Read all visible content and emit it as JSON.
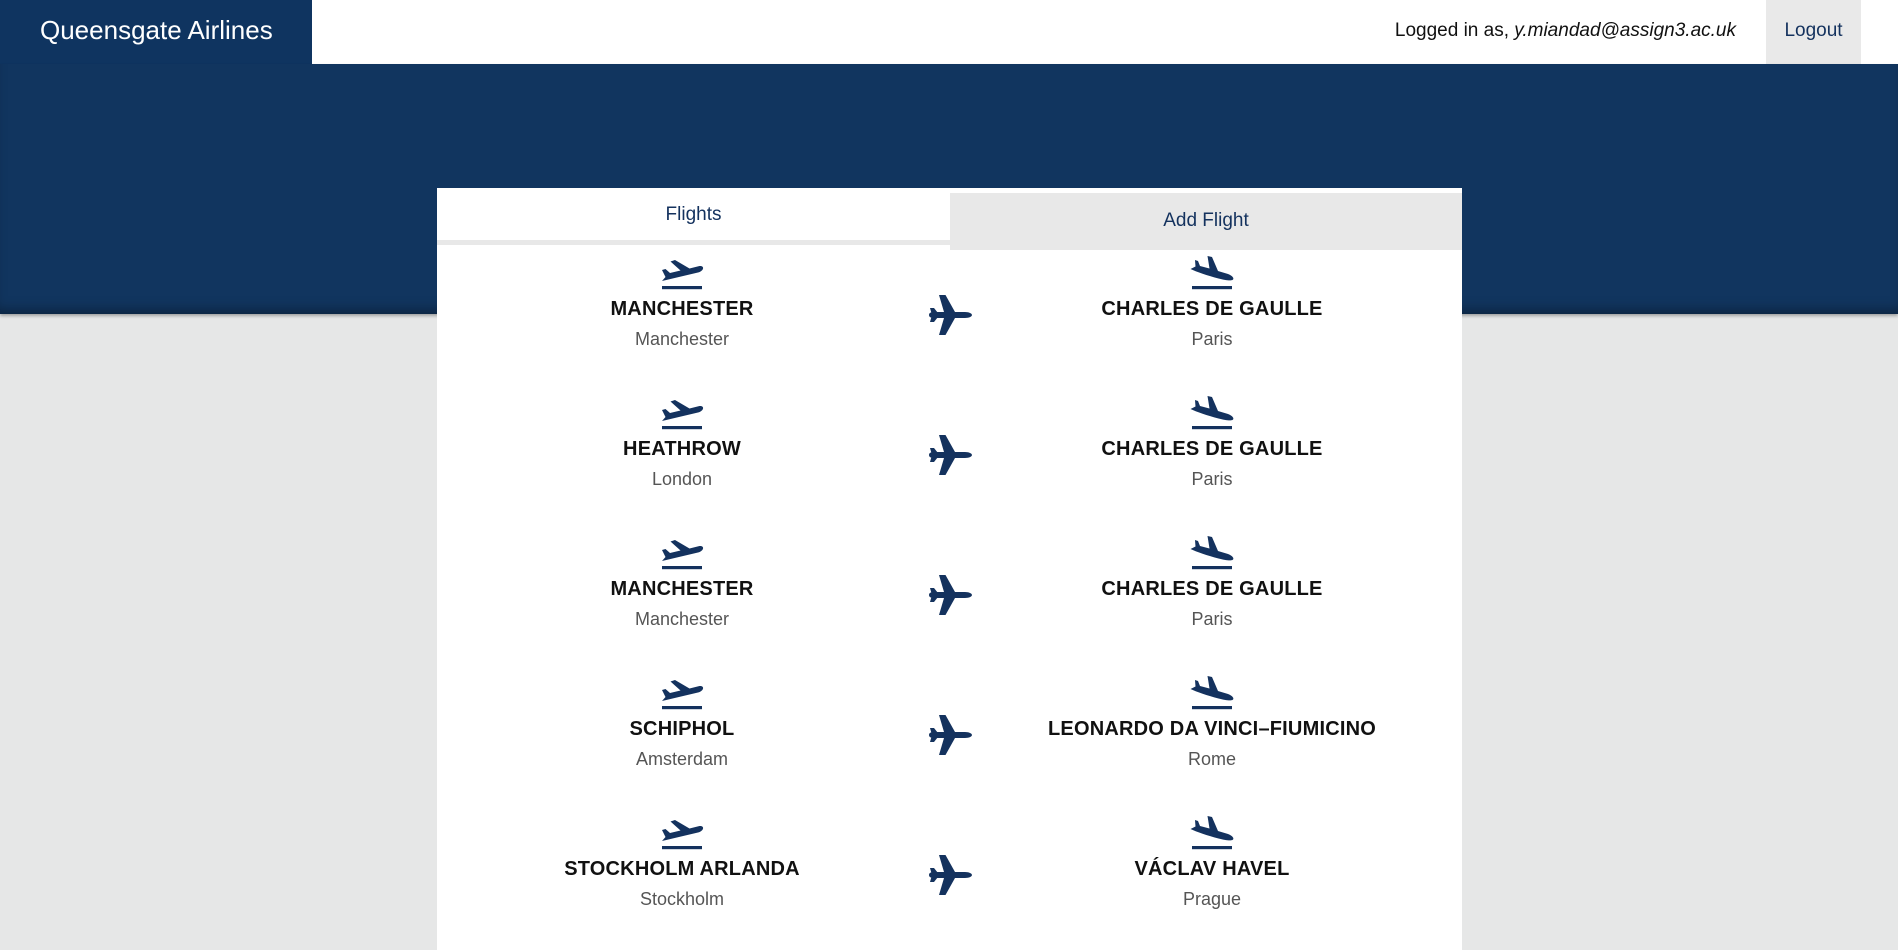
{
  "header": {
    "brand": "Queensgate Airlines",
    "logged_in_prefix": "Logged in as, ",
    "user_email": "y.miandad@assign3.ac.uk",
    "logout_label": "Logout"
  },
  "tabs": [
    {
      "label": "Flights",
      "active": true
    },
    {
      "label": "Add Flight",
      "active": false
    }
  ],
  "colors": {
    "brand": "#0f3460",
    "hero": "#11355f",
    "icon": "#14325e",
    "background": "#e6e7e7"
  },
  "icons": {
    "departure": "flight-takeoff-icon",
    "arrival": "flight-land-icon",
    "route": "airplane-icon"
  },
  "flights": [
    {
      "origin": {
        "airport": "MANCHESTER",
        "city": "Manchester"
      },
      "destination": {
        "airport": "CHARLES DE GAULLE",
        "city": "Paris"
      }
    },
    {
      "origin": {
        "airport": "HEATHROW",
        "city": "London"
      },
      "destination": {
        "airport": "CHARLES DE GAULLE",
        "city": "Paris"
      }
    },
    {
      "origin": {
        "airport": "MANCHESTER",
        "city": "Manchester"
      },
      "destination": {
        "airport": "CHARLES DE GAULLE",
        "city": "Paris"
      }
    },
    {
      "origin": {
        "airport": "SCHIPHOL",
        "city": "Amsterdam"
      },
      "destination": {
        "airport": "LEONARDO DA VINCI–FIUMICINO",
        "city": "Rome"
      }
    },
    {
      "origin": {
        "airport": "STOCKHOLM ARLANDA",
        "city": "Stockholm"
      },
      "destination": {
        "airport": "VÁCLAV HAVEL",
        "city": "Prague"
      }
    }
  ]
}
